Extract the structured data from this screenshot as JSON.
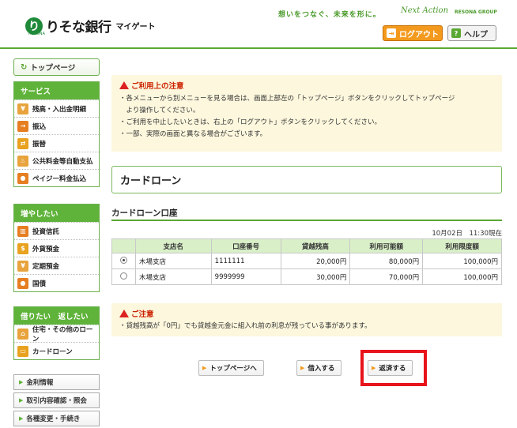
{
  "header": {
    "logo_mark": "り",
    "bank_name": "りそな銀行",
    "service_name": "マイゲート",
    "logo_small": "RESONA",
    "slogan": "想いをつなぐ、未来を形に。",
    "slogan_next": "Next Action",
    "group": "RESONA GROUP",
    "logout_label": "ログアウト",
    "help_label": "ヘルプ"
  },
  "sidebar": {
    "top_page": "トップページ",
    "groups": [
      {
        "title": "サービス",
        "items": [
          {
            "label": "残高・入出金明細",
            "icon": "wallet-icon",
            "color": "#e8a33c"
          },
          {
            "label": "振込",
            "icon": "transfer-icon",
            "color": "#e67e22"
          },
          {
            "label": "振替",
            "icon": "exchange-icon",
            "color": "#e9a21f"
          },
          {
            "label": "公共料金等自動支払",
            "icon": "faucet-icon",
            "color": "#e8a33c"
          },
          {
            "label": "ペイジー料金払込",
            "icon": "payeasy-icon",
            "color": "#e67e22"
          }
        ]
      },
      {
        "title": "増やしたい",
        "items": [
          {
            "label": "投資信託",
            "icon": "chart-icon",
            "color": "#e67e22"
          },
          {
            "label": "外貨預金",
            "icon": "dollar-icon",
            "color": "#e9a21f"
          },
          {
            "label": "定期預金",
            "icon": "yen-bag-icon",
            "color": "#e8a33c"
          },
          {
            "label": "国債",
            "icon": "bond-icon",
            "color": "#e67e22"
          }
        ]
      },
      {
        "title": "借りたい　返したい",
        "items": [
          {
            "label": "住宅・その他のローン",
            "icon": "house-icon",
            "color": "#e8a33c"
          },
          {
            "label": "カードローン",
            "icon": "card-icon",
            "color": "#e9a21f"
          }
        ]
      }
    ],
    "links": [
      "金利情報",
      "取引内容確認・照会",
      "各種変更・手続き"
    ]
  },
  "notice": {
    "title": "ご利用上の注意",
    "lines": [
      "・各メニューから別メニューを見る場合は、画面上部左の「トップページ」ボタンをクリックしてトップページ",
      "　より操作してください。",
      "・ご利用を中止したいときは、右上の「ログアウト」ボタンをクリックしてください。",
      "・一部、実際の画面と異なる場合がございます。"
    ]
  },
  "page_title": "カードローン",
  "section_title": "カードローン口座",
  "timestamp": "10月02日　11:30現在",
  "table": {
    "headers": [
      "支店名",
      "口座番号",
      "貸越残高",
      "利用可能額",
      "利用限度額"
    ],
    "rows": [
      {
        "selected": true,
        "cells": [
          "木場支店",
          "1111111",
          "20,000円",
          "80,000円",
          "100,000円"
        ]
      },
      {
        "selected": false,
        "cells": [
          "木場支店",
          "9999999",
          "30,000円",
          "70,000円",
          "100,000円"
        ]
      }
    ]
  },
  "caution": {
    "title": "ご注意",
    "line": "・貸越残高が「0円」でも貸越金元金に組入れ前の利息が残っている事があります。"
  },
  "actions": {
    "top": "トップページへ",
    "borrow": "借入する",
    "repay": "返済する"
  },
  "colors": {
    "accent_green": "#5aa832",
    "accent_orange": "#f39a1e",
    "highlight_red": "#e8141b"
  }
}
